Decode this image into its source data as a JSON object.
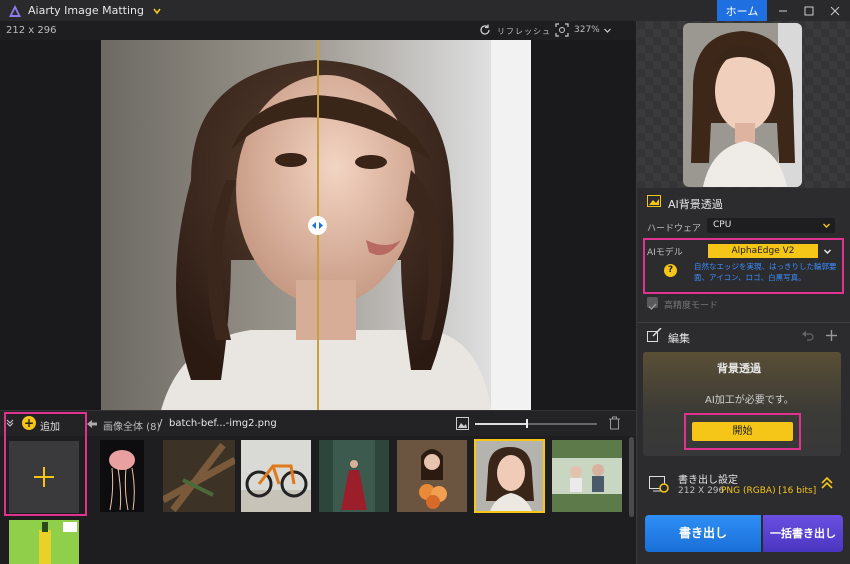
{
  "titlebar": {
    "app_title": "Aiarty Image Matting",
    "home_label": "ホーム"
  },
  "preview": {
    "dimensions": "212 x 296",
    "refresh_label": "リフレッシュ",
    "zoom_label": "327%"
  },
  "batch": {
    "add_label": "追加",
    "breadcrumb_all": "画像全体 (8)",
    "breadcrumb_sep": "/",
    "breadcrumb_file": "batch-bef...-img2.png",
    "thumb_size_fraction": 0.42
  },
  "thumbnails": [
    {
      "name": "jellyfish",
      "selected": false
    },
    {
      "name": "branch",
      "selected": false
    },
    {
      "name": "bicycle",
      "selected": false
    },
    {
      "name": "woman-red-dress",
      "selected": false
    },
    {
      "name": "woman-flowers",
      "selected": false
    },
    {
      "name": "woman-portrait",
      "selected": true
    },
    {
      "name": "couple",
      "selected": false
    },
    {
      "name": "green-bottle",
      "selected": false
    }
  ],
  "side": {
    "ai_section_title": "AI背景透過",
    "hardware_label": "ハードウェア",
    "hardware_value": "CPU",
    "model_label": "AIモデル",
    "model_value": "AlphaEdge  V2",
    "model_desc": "自然なエッジを実現、はっきりした輪郭要面、アイコン、ロゴ、白黒写真。",
    "hq_mode_label": "高精度モード",
    "edit_title": "編集",
    "bg_title": "背景透過",
    "ai_required": "AI加工が必要です。",
    "start_label": "開始",
    "export_title": "書き出し設定",
    "export_dims": "212 X 296",
    "export_format": "PNG (RGBA) [16 bits]",
    "export_label": "書き出し",
    "batch_export_label": "一括書き出し"
  },
  "colors": {
    "accent_yellow": "#f5c518",
    "accent_blue": "#1f6fe0",
    "highlight_pink": "#e0338f"
  }
}
